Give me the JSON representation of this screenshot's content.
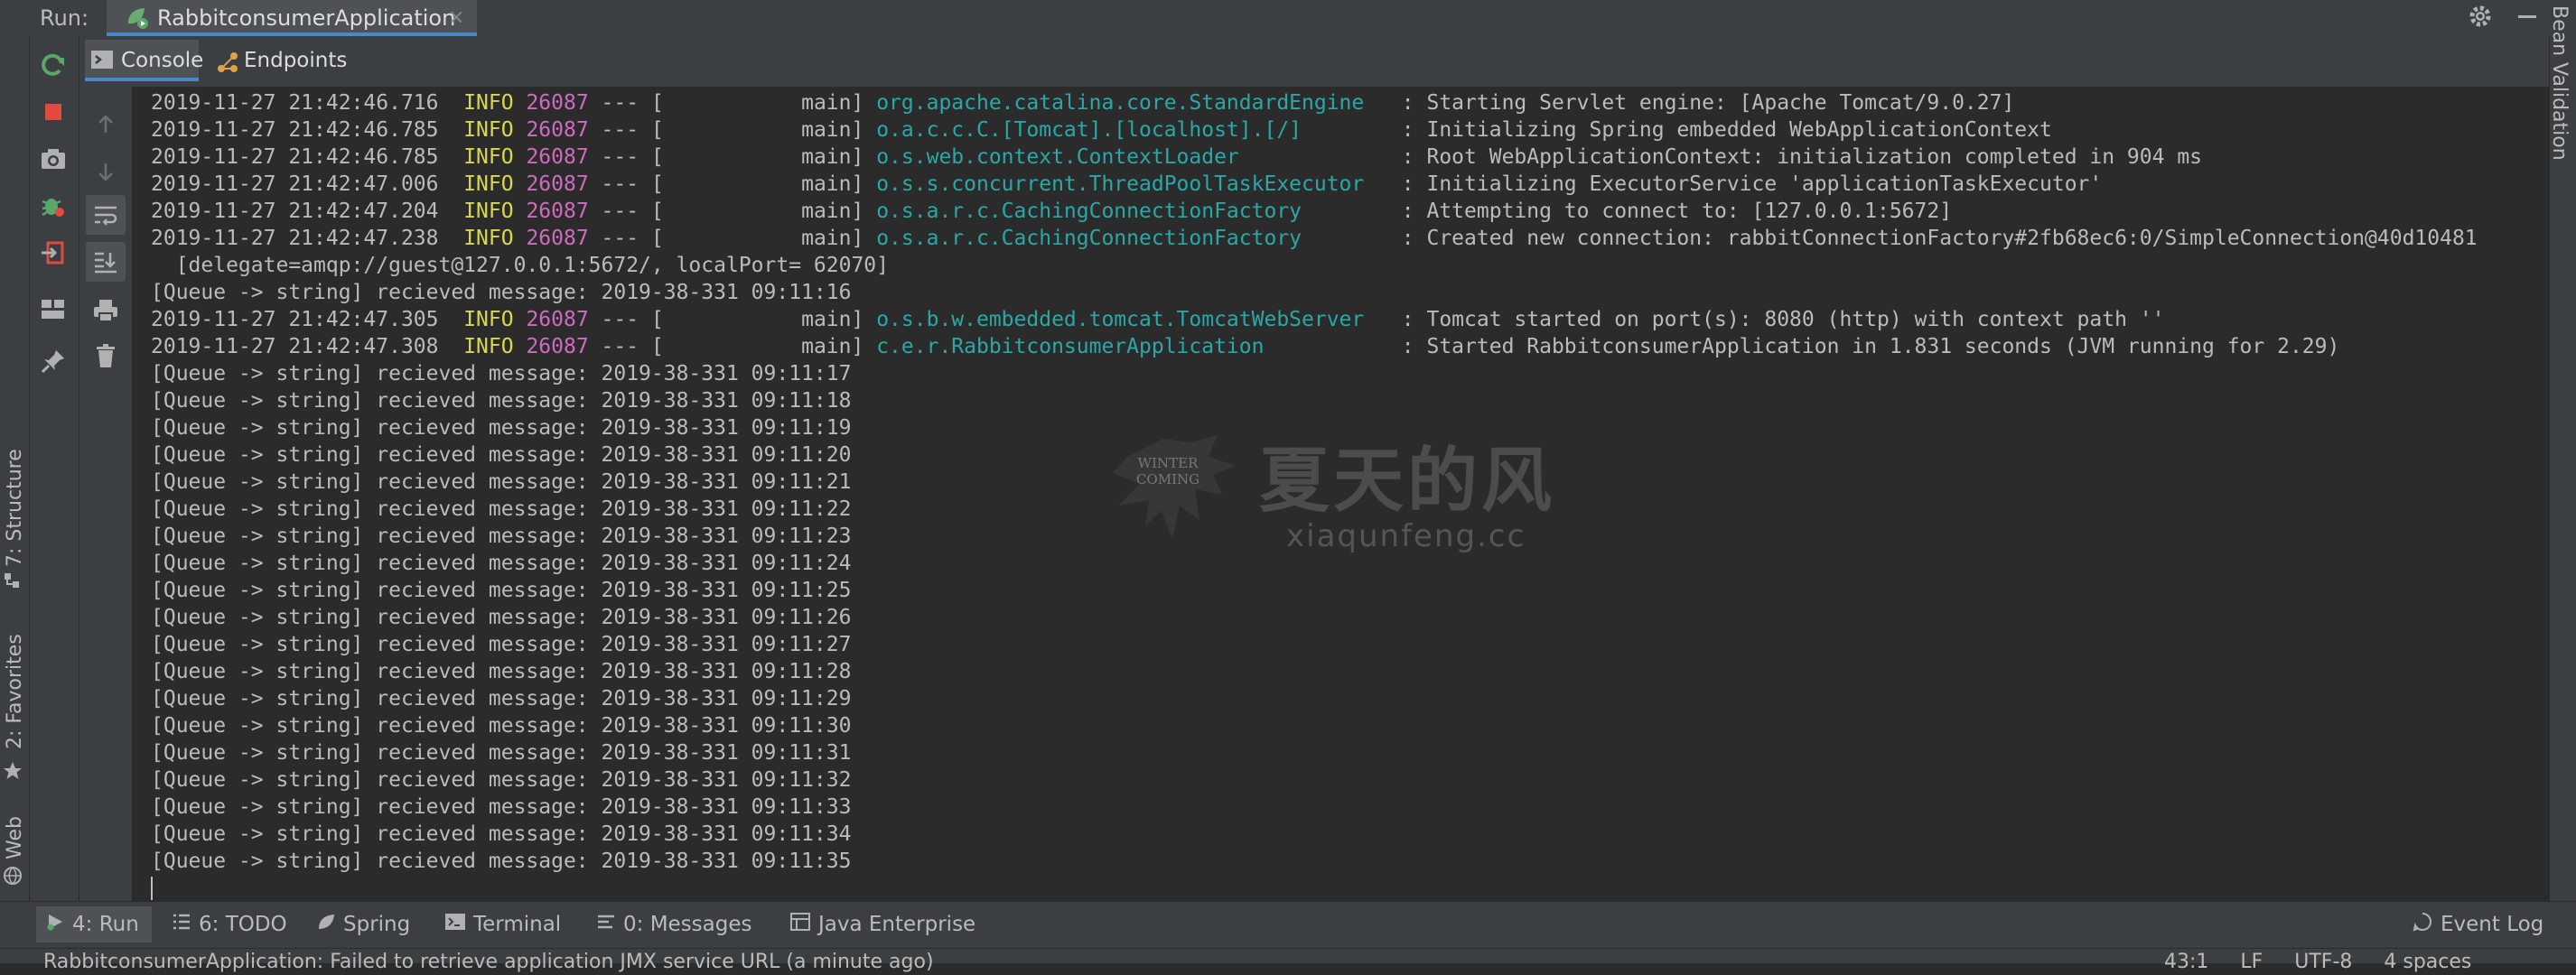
{
  "run_bar": {
    "label": "Run:",
    "tab_title": "RabbitconsumerApplication",
    "close_glyph": "×"
  },
  "subtabs": {
    "console": "Console",
    "endpoints": "Endpoints"
  },
  "left_strip": {
    "structure": "7: Structure",
    "favorites": "2: Favorites",
    "web": "Web"
  },
  "right_strip": {
    "bean_validation": "Bean Validation"
  },
  "console_lines": [
    {
      "ts": "2019-11-27 21:42:46.716",
      "level": "INFO",
      "pid": "26087",
      "sep": " --- [           main] ",
      "logger": "org.apache.catalina.core.StandardEngine  ",
      "msg": ": Starting Servlet engine: [Apache Tomcat/9.0.27]"
    },
    {
      "ts": "2019-11-27 21:42:46.785",
      "level": "INFO",
      "pid": "26087",
      "sep": " --- [           main] ",
      "logger": "o.a.c.c.C.[Tomcat].[localhost].[/]       ",
      "msg": ": Initializing Spring embedded WebApplicationContext"
    },
    {
      "ts": "2019-11-27 21:42:46.785",
      "level": "INFO",
      "pid": "26087",
      "sep": " --- [           main] ",
      "logger": "o.s.web.context.ContextLoader            ",
      "msg": ": Root WebApplicationContext: initialization completed in 904 ms"
    },
    {
      "ts": "2019-11-27 21:42:47.006",
      "level": "INFO",
      "pid": "26087",
      "sep": " --- [           main] ",
      "logger": "o.s.s.concurrent.ThreadPoolTaskExecutor  ",
      "msg": ": Initializing ExecutorService 'applicationTaskExecutor'"
    },
    {
      "ts": "2019-11-27 21:42:47.204",
      "level": "INFO",
      "pid": "26087",
      "sep": " --- [           main] ",
      "logger": "o.s.a.r.c.CachingConnectionFactory       ",
      "msg": ": Attempting to connect to: [127.0.0.1:5672]"
    },
    {
      "ts": "2019-11-27 21:42:47.238",
      "level": "INFO",
      "pid": "26087",
      "sep": " --- [           main] ",
      "logger": "o.s.a.r.c.CachingConnectionFactory       ",
      "msg": ": Created new connection: rabbitConnectionFactory#2fb68ec6:0/SimpleConnection@40d10481"
    },
    {
      "plain": "  [delegate=amqp://guest@127.0.0.1:5672/, localPort= 62070]"
    },
    {
      "plain": "[Queue -> string] recieved message: 2019-38-331 09:11:16"
    },
    {
      "ts": "2019-11-27 21:42:47.305",
      "level": "INFO",
      "pid": "26087",
      "sep": " --- [           main] ",
      "logger": "o.s.b.w.embedded.tomcat.TomcatWebServer  ",
      "msg": ": Tomcat started on port(s): 8080 (http) with context path ''"
    },
    {
      "ts": "2019-11-27 21:42:47.308",
      "level": "INFO",
      "pid": "26087",
      "sep": " --- [           main] ",
      "logger": "c.e.r.RabbitconsumerApplication          ",
      "msg": ": Started RabbitconsumerApplication in 1.831 seconds (JVM running for 2.29)"
    },
    {
      "plain": "[Queue -> string] recieved message: 2019-38-331 09:11:17"
    },
    {
      "plain": "[Queue -> string] recieved message: 2019-38-331 09:11:18"
    },
    {
      "plain": "[Queue -> string] recieved message: 2019-38-331 09:11:19"
    },
    {
      "plain": "[Queue -> string] recieved message: 2019-38-331 09:11:20"
    },
    {
      "plain": "[Queue -> string] recieved message: 2019-38-331 09:11:21"
    },
    {
      "plain": "[Queue -> string] recieved message: 2019-38-331 09:11:22"
    },
    {
      "plain": "[Queue -> string] recieved message: 2019-38-331 09:11:23"
    },
    {
      "plain": "[Queue -> string] recieved message: 2019-38-331 09:11:24"
    },
    {
      "plain": "[Queue -> string] recieved message: 2019-38-331 09:11:25"
    },
    {
      "plain": "[Queue -> string] recieved message: 2019-38-331 09:11:26"
    },
    {
      "plain": "[Queue -> string] recieved message: 2019-38-331 09:11:27"
    },
    {
      "plain": "[Queue -> string] recieved message: 2019-38-331 09:11:28"
    },
    {
      "plain": "[Queue -> string] recieved message: 2019-38-331 09:11:29"
    },
    {
      "plain": "[Queue -> string] recieved message: 2019-38-331 09:11:30"
    },
    {
      "plain": "[Queue -> string] recieved message: 2019-38-331 09:11:31"
    },
    {
      "plain": "[Queue -> string] recieved message: 2019-38-331 09:11:32"
    },
    {
      "plain": "[Queue -> string] recieved message: 2019-38-331 09:11:33"
    },
    {
      "plain": "[Queue -> string] recieved message: 2019-38-331 09:11:34"
    },
    {
      "plain": "[Queue -> string] recieved message: 2019-38-331 09:11:35"
    }
  ],
  "watermark": {
    "chinese": "夏天的风",
    "url": "xiaqunfeng.cc",
    "winter": "WINTER",
    "coming": "COMING"
  },
  "bottom_tabs": {
    "run": "4: Run",
    "todo": "6: TODO",
    "spring": "Spring",
    "terminal": "Terminal",
    "messages": "0: Messages",
    "java_enterprise": "Java Enterprise",
    "event_log": "Event Log"
  },
  "status_bar": {
    "message": "RabbitconsumerApplication: Failed to retrieve application JMX service URL (a minute ago)",
    "position": "43:1",
    "line_sep": "LF",
    "encoding": "UTF-8",
    "indent": "4 spaces"
  },
  "colors": {
    "info": "#d9d74f",
    "pid": "#cf6bbf",
    "logger": "#29a8a8",
    "accent": "#4a88c7",
    "stop_red": "#e04a3f",
    "rerun_green": "#59a869"
  }
}
